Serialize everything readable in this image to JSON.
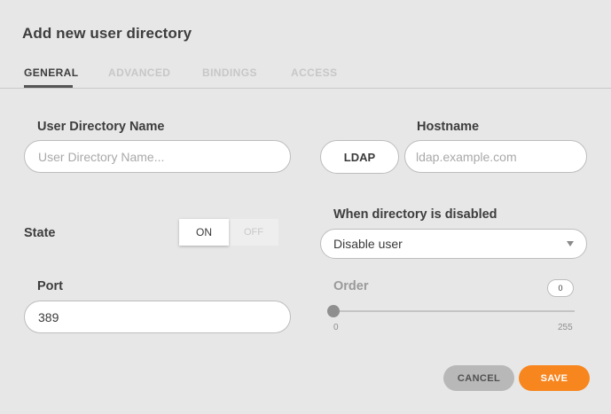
{
  "dialog": {
    "title": "Add new user directory"
  },
  "tabs": [
    {
      "label": "GENERAL",
      "active": true
    },
    {
      "label": "ADVANCED",
      "active": false
    },
    {
      "label": "BINDINGS",
      "active": false
    },
    {
      "label": "ACCESS",
      "active": false
    }
  ],
  "form": {
    "name": {
      "label": "User Directory Name",
      "placeholder": "User Directory Name...",
      "value": ""
    },
    "hostname": {
      "label": "Hostname",
      "protocol": "LDAP",
      "placeholder": "ldap.example.com",
      "value": ""
    },
    "state": {
      "label": "State",
      "on_label": "ON",
      "off_label": "OFF",
      "selected": "ON"
    },
    "disabled_behavior": {
      "label": "When directory is disabled",
      "selected": "Disable user"
    },
    "port": {
      "label": "Port",
      "value": "389"
    },
    "order": {
      "label": "Order",
      "value": "0",
      "min": "0",
      "max": "255"
    }
  },
  "actions": {
    "cancel_label": "CANCEL",
    "save_label": "SAVE"
  },
  "colors": {
    "background": "#e7e7e7",
    "accent": "#f7861f",
    "cancel": "#b8b8b8",
    "tab_active": "#3d3d3d",
    "tab_inactive": "#c7c7c7"
  }
}
